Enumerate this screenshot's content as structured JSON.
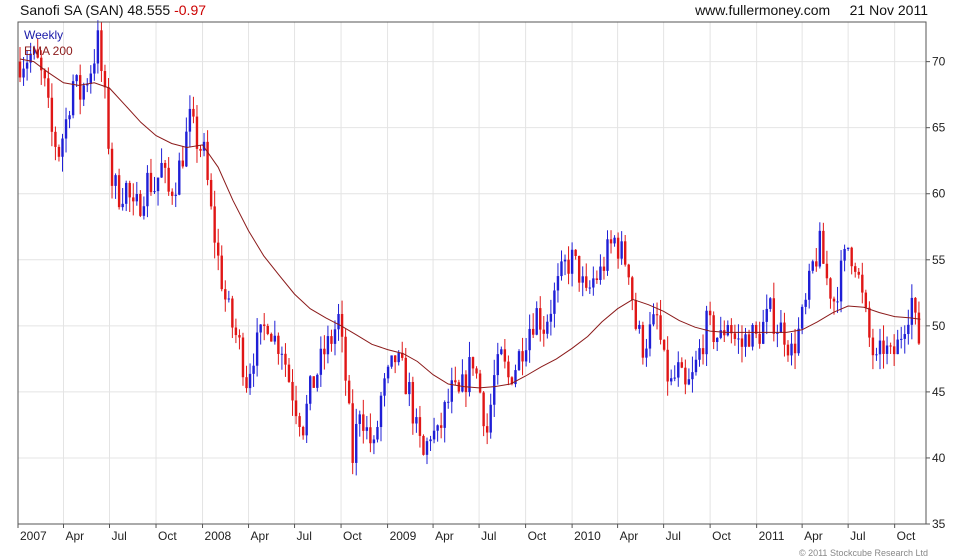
{
  "header": {
    "instrument": "Sanofi SA (SAN)",
    "price": "48.555",
    "change": "-0.97",
    "site": "www.fullermoney.com",
    "date": "21 Nov 2011"
  },
  "copyright": "© 2011 Stockcube Research Ltd",
  "colors": {
    "up": "#1f1fd6",
    "down": "#e01616",
    "ema": "#8b1a1a",
    "grid": "#e4e4e4",
    "frame": "#555555"
  },
  "chart_data": {
    "type": "line",
    "legend": [
      "Weekly",
      "EMA 200"
    ],
    "legend_position": "top-left",
    "grid": true,
    "ylim": [
      35,
      73
    ],
    "yticks": [
      35,
      40,
      45,
      50,
      55,
      60,
      65,
      70
    ],
    "xlim": [
      "2007-01-01",
      "2011-12-02"
    ],
    "xticks": [
      {
        "label": "2007",
        "date": "2007-01-01"
      },
      {
        "label": "Apr",
        "date": "2007-04-01"
      },
      {
        "label": "Jul",
        "date": "2007-07-01"
      },
      {
        "label": "Oct",
        "date": "2007-10-01"
      },
      {
        "label": "2008",
        "date": "2008-01-01"
      },
      {
        "label": "Apr",
        "date": "2008-04-01"
      },
      {
        "label": "Jul",
        "date": "2008-07-01"
      },
      {
        "label": "Oct",
        "date": "2008-10-01"
      },
      {
        "label": "2009",
        "date": "2009-01-01"
      },
      {
        "label": "Apr",
        "date": "2009-04-01"
      },
      {
        "label": "Jul",
        "date": "2009-07-01"
      },
      {
        "label": "Oct",
        "date": "2009-10-01"
      },
      {
        "label": "2010",
        "date": "2010-01-01"
      },
      {
        "label": "Apr",
        "date": "2010-04-01"
      },
      {
        "label": "Jul",
        "date": "2010-07-01"
      },
      {
        "label": "Oct",
        "date": "2010-10-01"
      },
      {
        "label": "2011",
        "date": "2011-01-01"
      },
      {
        "label": "Apr",
        "date": "2011-04-01"
      },
      {
        "label": "Jul",
        "date": "2011-07-01"
      },
      {
        "label": "Oct",
        "date": "2011-10-01"
      }
    ],
    "price_series": [
      [
        "2007-01-05",
        70.0
      ],
      [
        "2007-01-26",
        70.5
      ],
      [
        "2007-02-09",
        69.8
      ],
      [
        "2007-02-23",
        68.0
      ],
      [
        "2007-03-09",
        64.5
      ],
      [
        "2007-03-23",
        63.2
      ],
      [
        "2007-04-06",
        65.5
      ],
      [
        "2007-04-20",
        68.5
      ],
      [
        "2007-05-04",
        67.5
      ],
      [
        "2007-05-25",
        69.5
      ],
      [
        "2007-06-08",
        71.5
      ],
      [
        "2007-06-22",
        67.0
      ],
      [
        "2007-07-06",
        61.0
      ],
      [
        "2007-07-20",
        60.0
      ],
      [
        "2007-08-03",
        60.5
      ],
      [
        "2007-08-17",
        58.5
      ],
      [
        "2007-08-31",
        59.5
      ],
      [
        "2007-09-14",
        61.0
      ],
      [
        "2007-09-28",
        60.5
      ],
      [
        "2007-10-12",
        62.0
      ],
      [
        "2007-10-26",
        60.0
      ],
      [
        "2007-11-09",
        61.0
      ],
      [
        "2007-11-23",
        63.0
      ],
      [
        "2007-12-07",
        65.5
      ],
      [
        "2007-12-21",
        64.0
      ],
      [
        "2008-01-04",
        63.0
      ],
      [
        "2008-01-18",
        58.5
      ],
      [
        "2008-02-01",
        55.0
      ],
      [
        "2008-02-15",
        52.0
      ],
      [
        "2008-02-29",
        50.0
      ],
      [
        "2008-03-14",
        48.5
      ],
      [
        "2008-03-28",
        46.0
      ],
      [
        "2008-04-11",
        48.0
      ],
      [
        "2008-04-25",
        49.0
      ],
      [
        "2008-05-09",
        50.5
      ],
      [
        "2008-05-23",
        49.0
      ],
      [
        "2008-06-06",
        48.5
      ],
      [
        "2008-06-20",
        46.0
      ],
      [
        "2008-07-04",
        44.0
      ],
      [
        "2008-07-18",
        42.5
      ],
      [
        "2008-08-01",
        45.0
      ],
      [
        "2008-08-15",
        46.5
      ],
      [
        "2008-08-29",
        48.0
      ],
      [
        "2008-09-12",
        49.0
      ],
      [
        "2008-09-26",
        50.5
      ],
      [
        "2008-10-10",
        46.0
      ],
      [
        "2008-10-24",
        40.0
      ],
      [
        "2008-11-07",
        44.0
      ],
      [
        "2008-11-21",
        42.0
      ],
      [
        "2008-12-05",
        40.5
      ],
      [
        "2008-12-19",
        44.5
      ],
      [
        "2009-01-02",
        46.0
      ],
      [
        "2009-01-16",
        47.5
      ],
      [
        "2009-01-30",
        46.5
      ],
      [
        "2009-02-13",
        45.0
      ],
      [
        "2009-02-27",
        42.0
      ],
      [
        "2009-03-13",
        40.0
      ],
      [
        "2009-03-27",
        42.0
      ],
      [
        "2009-04-10",
        41.5
      ],
      [
        "2009-04-24",
        43.5
      ],
      [
        "2009-05-08",
        45.0
      ],
      [
        "2009-05-22",
        44.5
      ],
      [
        "2009-06-05",
        46.0
      ],
      [
        "2009-06-19",
        47.5
      ],
      [
        "2009-07-03",
        45.0
      ],
      [
        "2009-07-17",
        42.0
      ],
      [
        "2009-07-31",
        46.0
      ],
      [
        "2009-08-14",
        47.5
      ],
      [
        "2009-08-28",
        46.0
      ],
      [
        "2009-09-11",
        47.0
      ],
      [
        "2009-09-25",
        48.5
      ],
      [
        "2009-10-09",
        50.0
      ],
      [
        "2009-10-23",
        51.0
      ],
      [
        "2009-11-06",
        50.0
      ],
      [
        "2009-11-20",
        51.5
      ],
      [
        "2009-12-04",
        53.0
      ],
      [
        "2009-12-18",
        54.5
      ],
      [
        "2010-01-01",
        55.0
      ],
      [
        "2010-01-15",
        54.0
      ],
      [
        "2010-01-29",
        52.0
      ],
      [
        "2010-02-12",
        53.5
      ],
      [
        "2010-02-26",
        54.0
      ],
      [
        "2010-03-12",
        55.5
      ],
      [
        "2010-03-26",
        56.5
      ],
      [
        "2010-04-09",
        55.5
      ],
      [
        "2010-04-23",
        54.5
      ],
      [
        "2010-05-07",
        50.0
      ],
      [
        "2010-05-21",
        48.5
      ],
      [
        "2010-06-04",
        49.5
      ],
      [
        "2010-06-18",
        50.5
      ],
      [
        "2010-07-02",
        47.0
      ],
      [
        "2010-07-16",
        45.5
      ],
      [
        "2010-07-30",
        46.5
      ],
      [
        "2010-08-13",
        45.0
      ],
      [
        "2010-08-27",
        46.0
      ],
      [
        "2010-09-10",
        48.0
      ],
      [
        "2010-09-24",
        50.0
      ],
      [
        "2010-10-08",
        49.5
      ],
      [
        "2010-10-22",
        49.0
      ],
      [
        "2010-11-05",
        50.5
      ],
      [
        "2010-11-19",
        49.0
      ],
      [
        "2010-12-03",
        48.5
      ],
      [
        "2010-12-17",
        49.5
      ],
      [
        "2010-12-31",
        49.0
      ],
      [
        "2011-01-14",
        50.0
      ],
      [
        "2011-01-28",
        51.0
      ],
      [
        "2011-02-11",
        50.0
      ],
      [
        "2011-02-25",
        49.5
      ],
      [
        "2011-03-11",
        48.0
      ],
      [
        "2011-03-25",
        49.5
      ],
      [
        "2011-04-08",
        51.5
      ],
      [
        "2011-04-22",
        54.5
      ],
      [
        "2011-05-06",
        56.0
      ],
      [
        "2011-05-20",
        53.5
      ],
      [
        "2011-06-03",
        52.0
      ],
      [
        "2011-06-17",
        54.0
      ],
      [
        "2011-07-01",
        56.0
      ],
      [
        "2011-07-15",
        55.0
      ],
      [
        "2011-07-29",
        52.0
      ],
      [
        "2011-08-12",
        49.0
      ],
      [
        "2011-08-26",
        47.0
      ],
      [
        "2011-09-09",
        48.5
      ],
      [
        "2011-09-23",
        47.5
      ],
      [
        "2011-10-07",
        48.5
      ],
      [
        "2011-10-21",
        50.5
      ],
      [
        "2011-11-04",
        52.0
      ],
      [
        "2011-11-11",
        50.0
      ],
      [
        "2011-11-21",
        48.555
      ]
    ],
    "ema_series": [
      [
        "2007-01-05",
        70.2
      ],
      [
        "2007-02-01",
        70.0
      ],
      [
        "2007-03-01",
        69.2
      ],
      [
        "2007-04-01",
        68.4
      ],
      [
        "2007-05-01",
        68.2
      ],
      [
        "2007-06-01",
        68.4
      ],
      [
        "2007-07-01",
        68.0
      ],
      [
        "2007-08-01",
        66.7
      ],
      [
        "2007-09-01",
        65.4
      ],
      [
        "2007-10-01",
        64.4
      ],
      [
        "2007-11-01",
        63.8
      ],
      [
        "2007-12-01",
        63.5
      ],
      [
        "2008-01-01",
        63.7
      ],
      [
        "2008-02-01",
        62.0
      ],
      [
        "2008-03-01",
        59.5
      ],
      [
        "2008-04-01",
        57.2
      ],
      [
        "2008-05-01",
        55.3
      ],
      [
        "2008-06-01",
        53.8
      ],
      [
        "2008-07-01",
        52.4
      ],
      [
        "2008-08-01",
        51.3
      ],
      [
        "2008-09-01",
        50.6
      ],
      [
        "2008-10-01",
        50.0
      ],
      [
        "2008-11-01",
        49.3
      ],
      [
        "2008-12-01",
        48.6
      ],
      [
        "2009-01-01",
        48.2
      ],
      [
        "2009-02-01",
        47.9
      ],
      [
        "2009-03-01",
        47.3
      ],
      [
        "2009-04-01",
        46.3
      ],
      [
        "2009-05-01",
        45.6
      ],
      [
        "2009-06-01",
        45.4
      ],
      [
        "2009-07-01",
        45.3
      ],
      [
        "2009-08-01",
        45.4
      ],
      [
        "2009-09-01",
        45.6
      ],
      [
        "2009-10-01",
        46.2
      ],
      [
        "2009-11-01",
        46.9
      ],
      [
        "2009-12-01",
        47.5
      ],
      [
        "2010-01-01",
        48.3
      ],
      [
        "2010-02-01",
        49.2
      ],
      [
        "2010-03-01",
        50.3
      ],
      [
        "2010-04-01",
        51.3
      ],
      [
        "2010-05-01",
        52.0
      ],
      [
        "2010-06-01",
        51.6
      ],
      [
        "2010-07-01",
        51.1
      ],
      [
        "2010-08-01",
        50.4
      ],
      [
        "2010-09-01",
        49.9
      ],
      [
        "2010-10-01",
        49.6
      ],
      [
        "2010-11-01",
        49.5
      ],
      [
        "2010-12-01",
        49.5
      ],
      [
        "2011-01-01",
        49.5
      ],
      [
        "2011-02-01",
        49.5
      ],
      [
        "2011-03-01",
        49.5
      ],
      [
        "2011-04-01",
        49.7
      ],
      [
        "2011-05-01",
        50.3
      ],
      [
        "2011-06-01",
        51.0
      ],
      [
        "2011-07-01",
        51.5
      ],
      [
        "2011-08-01",
        51.4
      ],
      [
        "2011-09-01",
        51.0
      ],
      [
        "2011-10-01",
        50.7
      ],
      [
        "2011-11-01",
        50.6
      ],
      [
        "2011-11-21",
        50.5
      ]
    ]
  }
}
